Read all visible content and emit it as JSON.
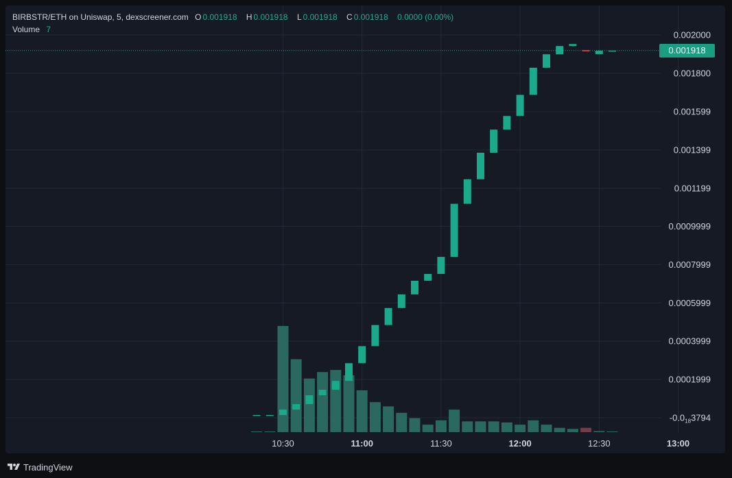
{
  "header": {
    "symbol": "BIRBSTR/ETH on Uniswap, 5, dexscreener.com",
    "open_label": "O",
    "open_value": "0.001918",
    "high_label": "H",
    "high_value": "0.001918",
    "low_label": "L",
    "low_value": "0.001918",
    "close_label": "C",
    "close_value": "0.001918",
    "change_value": "0.0000 (0.00%)",
    "volume_label": "Volume",
    "volume_value": "7"
  },
  "current_price_tag": "0.001918",
  "footer": {
    "brand": "TradingView"
  },
  "colors": {
    "up": "#26a69a",
    "up_body": "#1aa98a",
    "down": "#ef5350",
    "volume_up": "#2c6d63",
    "volume_down": "#7a3d4b",
    "grid": "#232838",
    "text": "#d1d4dc",
    "panel": "#161a25",
    "tag": "#1a9e82"
  },
  "chart_data": {
    "type": "candlestick",
    "interval": "5",
    "y_ticks": [
      {
        "value": 0.002,
        "label": "0.002000"
      },
      {
        "value": 0.0018,
        "label": "0.001800"
      },
      {
        "value": 0.001599,
        "label": "0.001599"
      },
      {
        "value": 0.001399,
        "label": "0.001399"
      },
      {
        "value": 0.001199,
        "label": "0.001199"
      },
      {
        "value": 0.0009999,
        "label": "0.0009999"
      },
      {
        "value": 0.0007999,
        "label": "0.0007999"
      },
      {
        "value": 0.0005999,
        "label": "0.0005999"
      },
      {
        "value": 0.0003999,
        "label": "0.0003999"
      },
      {
        "value": 0.0001999,
        "label": "0.0001999"
      },
      {
        "value": 0.0,
        "label_main": "-0.0",
        "label_sub": "18",
        "label_tail": "3794"
      }
    ],
    "x_ticks": [
      {
        "time": "10:30",
        "label": "10:30",
        "bold": false
      },
      {
        "time": "11:00",
        "label": "11:00",
        "bold": true
      },
      {
        "time": "11:30",
        "label": "11:30",
        "bold": false
      },
      {
        "time": "12:00",
        "label": "12:00",
        "bold": true
      },
      {
        "time": "12:30",
        "label": "12:30",
        "bold": false
      },
      {
        "time": "13:00",
        "label": "13:00",
        "bold": true
      }
    ],
    "candles": [
      {
        "time": "10:20",
        "open": 1.42e-05,
        "high": 1.42e-05,
        "low": 1.42e-05,
        "close": 1.42e-05,
        "volume": 0.1
      },
      {
        "time": "10:25",
        "open": 1.42e-05,
        "high": 1.42e-05,
        "low": 1.42e-05,
        "close": 1.42e-05,
        "volume": 0.1
      },
      {
        "time": "10:30",
        "open": 1.42e-05,
        "high": 4.27e-05,
        "low": 1.42e-05,
        "close": 4.27e-05,
        "volume": 99
      },
      {
        "time": "10:35",
        "open": 4.27e-05,
        "high": 7.12e-05,
        "low": 4.27e-05,
        "close": 7.12e-05,
        "volume": 68
      },
      {
        "time": "10:40",
        "open": 7.12e-05,
        "high": 0.0001175,
        "low": 7.12e-05,
        "close": 0.0001175,
        "volume": 50
      },
      {
        "time": "10:45",
        "open": 0.0001175,
        "high": 0.000146,
        "low": 0.0001175,
        "close": 0.000146,
        "volume": 56
      },
      {
        "time": "10:50",
        "open": 0.000146,
        "high": 0.0001923,
        "low": 0.000146,
        "close": 0.0001923,
        "volume": 58
      },
      {
        "time": "10:55",
        "open": 0.0001923,
        "high": 0.000285,
        "low": 0.0001923,
        "close": 0.000285,
        "volume": 53
      },
      {
        "time": "11:00",
        "open": 0.000285,
        "high": 0.000374,
        "low": 0.000285,
        "close": 0.000374,
        "volume": 39
      },
      {
        "time": "11:05",
        "open": 0.000374,
        "high": 0.0004843,
        "low": 0.000374,
        "close": 0.0004843,
        "volume": 28
      },
      {
        "time": "11:10",
        "open": 0.0004843,
        "high": 0.0005733,
        "low": 0.0004843,
        "close": 0.0005733,
        "volume": 24
      },
      {
        "time": "11:15",
        "open": 0.0005733,
        "high": 0.0006445,
        "low": 0.0005733,
        "close": 0.0006445,
        "volume": 18
      },
      {
        "time": "11:20",
        "open": 0.0006445,
        "high": 0.0007157,
        "low": 0.0006445,
        "close": 0.0007157,
        "volume": 13
      },
      {
        "time": "11:25",
        "open": 0.0007157,
        "high": 0.0007513,
        "low": 0.0007157,
        "close": 0.0007513,
        "volume": 7
      },
      {
        "time": "11:30",
        "open": 0.0007513,
        "high": 0.0008403,
        "low": 0.0007513,
        "close": 0.0008403,
        "volume": 11
      },
      {
        "time": "11:35",
        "open": 0.0008403,
        "high": 0.0011177,
        "low": 0.0008403,
        "close": 0.0011177,
        "volume": 21
      },
      {
        "time": "11:40",
        "open": 0.0011177,
        "high": 0.001246,
        "low": 0.0011177,
        "close": 0.001246,
        "volume": 10
      },
      {
        "time": "11:45",
        "open": 0.001246,
        "high": 0.0013847,
        "low": 0.001246,
        "close": 0.0013847,
        "volume": 10
      },
      {
        "time": "11:50",
        "open": 0.0013847,
        "high": 0.0015054,
        "low": 0.0013847,
        "close": 0.0015054,
        "volume": 10
      },
      {
        "time": "11:55",
        "open": 0.0015054,
        "high": 0.0015766,
        "low": 0.0015054,
        "close": 0.0015766,
        "volume": 9
      },
      {
        "time": "12:00",
        "open": 0.0015766,
        "high": 0.0016869,
        "low": 0.0015766,
        "close": 0.0016869,
        "volume": 7
      },
      {
        "time": "12:05",
        "open": 0.0016869,
        "high": 0.0018287,
        "low": 0.0016869,
        "close": 0.0018287,
        "volume": 11
      },
      {
        "time": "12:10",
        "open": 0.0018287,
        "high": 0.001899,
        "low": 0.0018287,
        "close": 0.001899,
        "volume": 7
      },
      {
        "time": "12:15",
        "open": 0.001899,
        "high": 0.001942,
        "low": 0.001899,
        "close": 0.001942,
        "volume": 4
      },
      {
        "time": "12:20",
        "open": 0.001942,
        "high": 0.0019525,
        "low": 0.0019382,
        "close": 0.0019525,
        "volume": 3
      },
      {
        "time": "12:25",
        "open": 0.00192,
        "high": 0.00192,
        "low": 0.00192,
        "close": 0.001918,
        "volume": 4
      },
      {
        "time": "12:30",
        "open": 0.0019,
        "high": 0.00192,
        "low": 0.0019,
        "close": 0.001918,
        "volume": 1
      },
      {
        "time": "12:35",
        "open": 0.001918,
        "high": 0.001918,
        "low": 0.001918,
        "close": 0.001918,
        "volume": 0.1
      }
    ],
    "last_price": 0.001918
  }
}
